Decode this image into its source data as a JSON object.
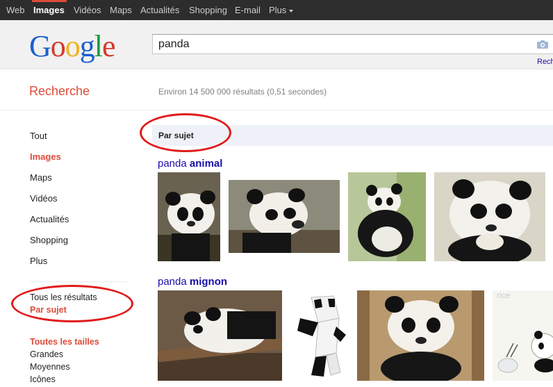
{
  "topnav": {
    "items": [
      "Web",
      "Images",
      "Vidéos",
      "Maps",
      "Actualités",
      "Shopping",
      "E-mail",
      "Plus"
    ],
    "active": "Images"
  },
  "logo": {
    "letters": [
      "G",
      "o",
      "o",
      "g",
      "l",
      "e"
    ]
  },
  "search": {
    "value": "panda",
    "side_link": "Rech"
  },
  "results": {
    "title": "Recherche",
    "stats": "Environ 14 500 000 résultats (0,51 secondes)"
  },
  "sidebar": {
    "items": [
      "Tout",
      "Images",
      "Maps",
      "Vidéos",
      "Actualités",
      "Shopping",
      "Plus"
    ],
    "active": "Images",
    "mode_all": "Tous les résultats",
    "mode_subject": "Par sujet",
    "size_heading": "Toutes les tailles",
    "sizes": [
      "Grandes",
      "Moyennes",
      "Icônes"
    ]
  },
  "main": {
    "subject_header": "Par sujet",
    "groups": [
      {
        "prefix": "panda ",
        "keyword": "animal"
      },
      {
        "prefix": "panda ",
        "keyword": "mignon"
      }
    ],
    "thumb_watermark": "rice"
  },
  "colors": {
    "accent_red": "#dd4b39",
    "link_blue": "#1a0dab",
    "topbar": "#2d2d2d",
    "annotation": "#e11b1b"
  }
}
